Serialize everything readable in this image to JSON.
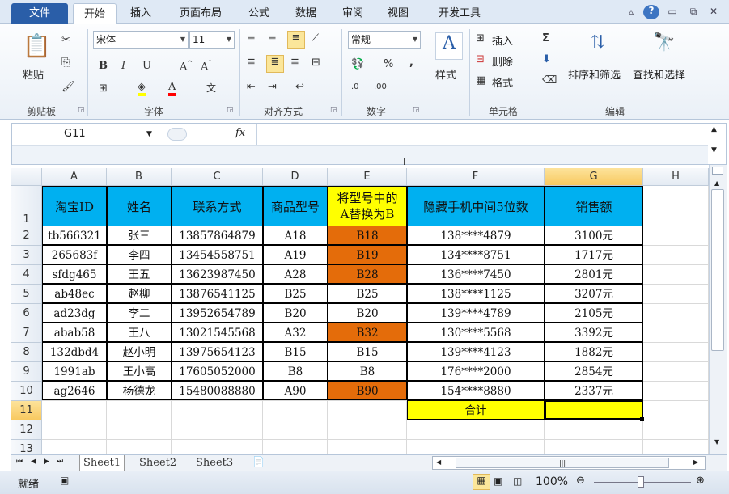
{
  "tabs": [
    "文件",
    "开始",
    "插入",
    "页面布局",
    "公式",
    "数据",
    "审阅",
    "视图",
    "开发工具"
  ],
  "ribbon": {
    "clipboard": {
      "paste": "粘贴",
      "label": "剪贴板"
    },
    "font": {
      "name": "宋体",
      "size": "11",
      "label": "字体",
      "wen": "文"
    },
    "align": {
      "label": "对齐方式"
    },
    "number": {
      "format": "常规",
      "label": "数字",
      "percent": "%",
      "comma": ","
    },
    "styles": {
      "label": "样式"
    },
    "cells": {
      "insert": "插入",
      "delete": "删除",
      "format": "格式",
      "label": "单元格"
    },
    "editing": {
      "sort": "排序和筛选",
      "find": "查找和选择",
      "label": "编辑"
    }
  },
  "formula_bar": {
    "name_box": "G11",
    "fx": "fx",
    "value": ""
  },
  "columns": [
    "A",
    "B",
    "C",
    "D",
    "E",
    "F",
    "G",
    "H"
  ],
  "rows": [
    "1",
    "2",
    "3",
    "4",
    "5",
    "6",
    "7",
    "8",
    "9",
    "10",
    "11",
    "12",
    "13"
  ],
  "headers": {
    "a": "淘宝ID",
    "b": "姓名",
    "c": "联系方式",
    "d": "商品型号",
    "e1": "将型号中的",
    "e2": "A替换为B",
    "f": "隐藏手机中间5位数",
    "g": "销售额"
  },
  "data_rows": [
    [
      "tb566321",
      "张三",
      "13857864879",
      "A18",
      "B18",
      "138****4879",
      "3100元"
    ],
    [
      "265683f",
      "李四",
      "13454558751",
      "A19",
      "B19",
      "134****8751",
      "1717元"
    ],
    [
      "sfdg465",
      "王五",
      "13623987450",
      "A28",
      "B28",
      "136****7450",
      "2801元"
    ],
    [
      "ab48ec",
      "赵柳",
      "13876541125",
      "B25",
      "B25",
      "138****1125",
      "3207元"
    ],
    [
      "ad23dg",
      "李二",
      "13952654789",
      "B20",
      "B20",
      "139****4789",
      "2105元"
    ],
    [
      "abab58",
      "王八",
      "13021545568",
      "A32",
      "B32",
      "130****5568",
      "3392元"
    ],
    [
      "132dbd4",
      "赵小明",
      "13975654123",
      "B15",
      "B15",
      "139****4123",
      "1882元"
    ],
    [
      "1991ab",
      "王小高",
      "17605052000",
      "B8",
      "B8",
      "176****2000",
      "2854元"
    ],
    [
      "ag2646",
      "杨德龙",
      "15480088880",
      "A90",
      "B90",
      "154****8880",
      "2337元"
    ]
  ],
  "orange_rows": [
    0,
    1,
    2,
    5,
    8
  ],
  "total_label": "合计",
  "sheets": [
    "Sheet1",
    "Sheet2",
    "Sheet3"
  ],
  "status": {
    "ready": "就绪",
    "zoom": "100%"
  },
  "colors": {
    "header_blue": "#00b0f0",
    "yellow": "#ffff00",
    "orange": "#e46c0a",
    "file_tab": "#2a5ea8"
  }
}
